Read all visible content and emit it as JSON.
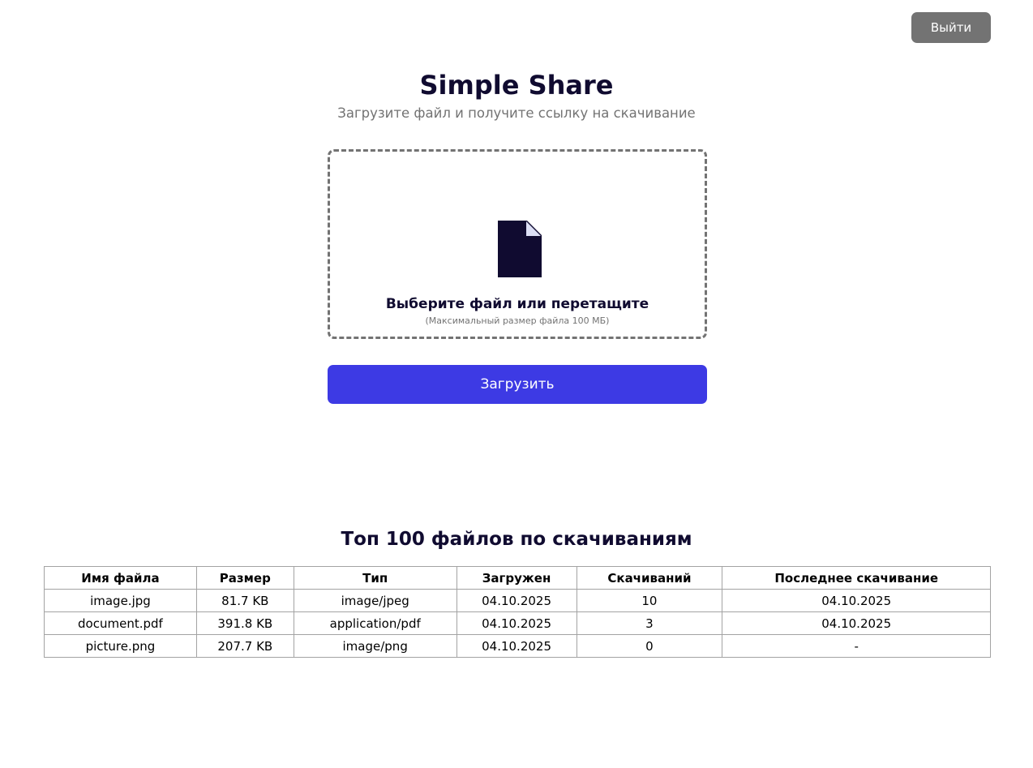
{
  "header": {
    "logout_label": "Выйти"
  },
  "hero": {
    "title": "Simple Share",
    "subtitle": "Загрузите файл и получите ссылку на скачивание"
  },
  "dropzone": {
    "icon": "file-icon",
    "label": "Выберите файл или перетащите",
    "hint": "(Максимальный размер файла 100 МБ)"
  },
  "upload": {
    "label": "Загрузить"
  },
  "top_files": {
    "title": "Топ 100 файлов по скачиваниям",
    "columns": [
      "Имя файла",
      "Размер",
      "Тип",
      "Загружен",
      "Скачиваний",
      "Последнее скачивание"
    ],
    "rows": [
      [
        "image.jpg",
        "81.7 KB",
        "image/jpeg",
        "04.10.2025",
        "10",
        "04.10.2025"
      ],
      [
        "document.pdf",
        "391.8 KB",
        "application/pdf",
        "04.10.2025",
        "3",
        "04.10.2025"
      ],
      [
        "picture.png",
        "207.7 KB",
        "image/png",
        "04.10.2025",
        "0",
        "-"
      ]
    ]
  },
  "colors": {
    "primary": "#3d3ae4",
    "dark_text": "#100b30",
    "muted": "#737373",
    "table_border": "#a3a3a3"
  }
}
